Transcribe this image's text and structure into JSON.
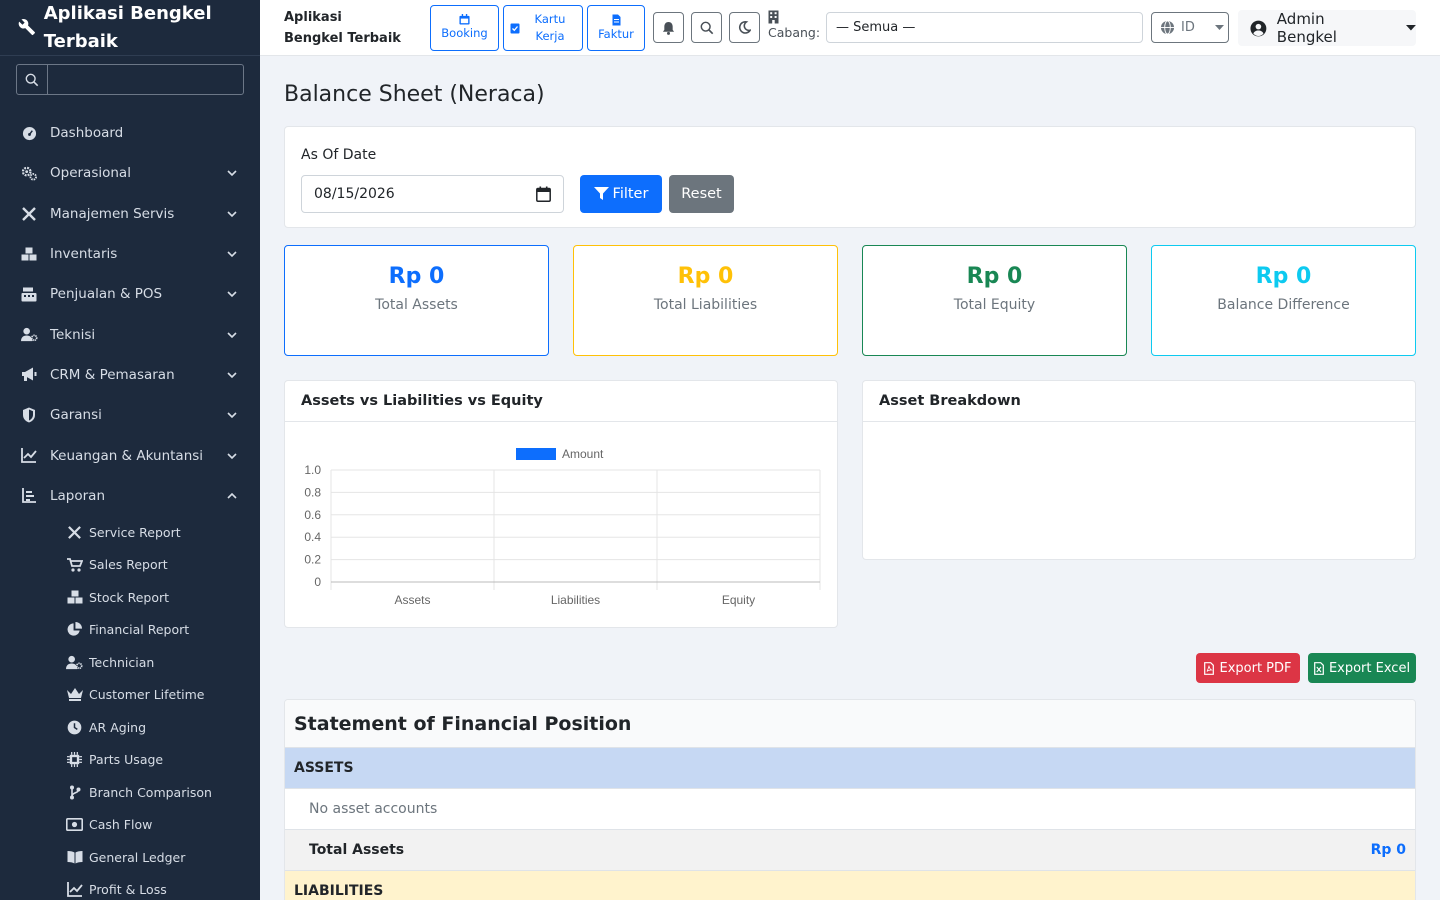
{
  "app": {
    "brand": "Aplikasi Bengkel Terbaik"
  },
  "sidebar": {
    "search_placeholder": "",
    "items": [
      {
        "label": "Dashboard"
      },
      {
        "label": "Operasional"
      },
      {
        "label": "Manajemen Servis"
      },
      {
        "label": "Inventaris"
      },
      {
        "label": "Penjualan & POS"
      },
      {
        "label": "Teknisi"
      },
      {
        "label": "CRM & Pemasaran"
      },
      {
        "label": "Garansi"
      },
      {
        "label": "Keuangan & Akuntansi"
      },
      {
        "label": "Laporan"
      }
    ],
    "laporan_sub": [
      {
        "label": "Service Report",
        "icon": "tools-icon"
      },
      {
        "label": "Sales Report",
        "icon": "cart-icon"
      },
      {
        "label": "Stock Report",
        "icon": "boxes-icon"
      },
      {
        "label": "Financial Report",
        "icon": "pie-chart-icon"
      },
      {
        "label": "Technician",
        "icon": "user-gear-icon"
      },
      {
        "label": "Customer Lifetime",
        "icon": "crown-icon"
      },
      {
        "label": "AR Aging",
        "icon": "clock-icon"
      },
      {
        "label": "Parts Usage",
        "icon": "chip-icon"
      },
      {
        "label": "Branch Comparison",
        "icon": "branch-icon"
      },
      {
        "label": "Cash Flow",
        "icon": "money-icon"
      },
      {
        "label": "General Ledger",
        "icon": "book-icon"
      },
      {
        "label": "Profit & Loss",
        "icon": "line-chart-icon"
      }
    ]
  },
  "topbar": {
    "title": "Aplikasi Bengkel Terbaik",
    "quick": [
      {
        "label": "Booking"
      },
      {
        "label": "Kartu Kerja"
      },
      {
        "label": "Faktur"
      }
    ],
    "cabang_label": "Cabang:",
    "branch_value": "— Semua —",
    "language": "ID",
    "user": "Admin Bengkel"
  },
  "page": {
    "title": "Balance Sheet (Neraca)",
    "filter": {
      "label": "As Of Date",
      "date_value": "08/15/2026",
      "filter_label": "Filter",
      "reset_label": "Reset"
    },
    "stats": [
      {
        "value": "Rp 0",
        "label": "Total Assets",
        "color": "#0d6efd"
      },
      {
        "value": "Rp 0",
        "label": "Total Liabilities",
        "color": "#ffc107"
      },
      {
        "value": "Rp 0",
        "label": "Total Equity",
        "color": "#198754"
      },
      {
        "value": "Rp 0",
        "label": "Balance Difference",
        "color": "#0dcaf0"
      }
    ],
    "chart_title": "Assets vs Liabilities vs Equity",
    "breakdown_title": "Asset Breakdown",
    "export_pdf": "Export PDF",
    "export_excel": "Export Excel",
    "statement": {
      "title": "Statement of Financial Position",
      "assets_header": "ASSETS",
      "no_assets": "No asset accounts",
      "total_assets_label": "Total Assets",
      "total_assets_value": "Rp 0",
      "liabilities_header": "LIABILITIES"
    }
  },
  "chart_data": {
    "type": "bar",
    "categories": [
      "Assets",
      "Liabilities",
      "Equity"
    ],
    "series": [
      {
        "name": "Amount",
        "values": [
          0,
          0,
          0
        ],
        "color": "#0d6efd"
      }
    ],
    "ylim": [
      0,
      1.0
    ],
    "yticks": [
      "0",
      "0.2",
      "0.4",
      "0.6",
      "0.8",
      "1.0"
    ],
    "legend": "top-center",
    "grid": true
  }
}
